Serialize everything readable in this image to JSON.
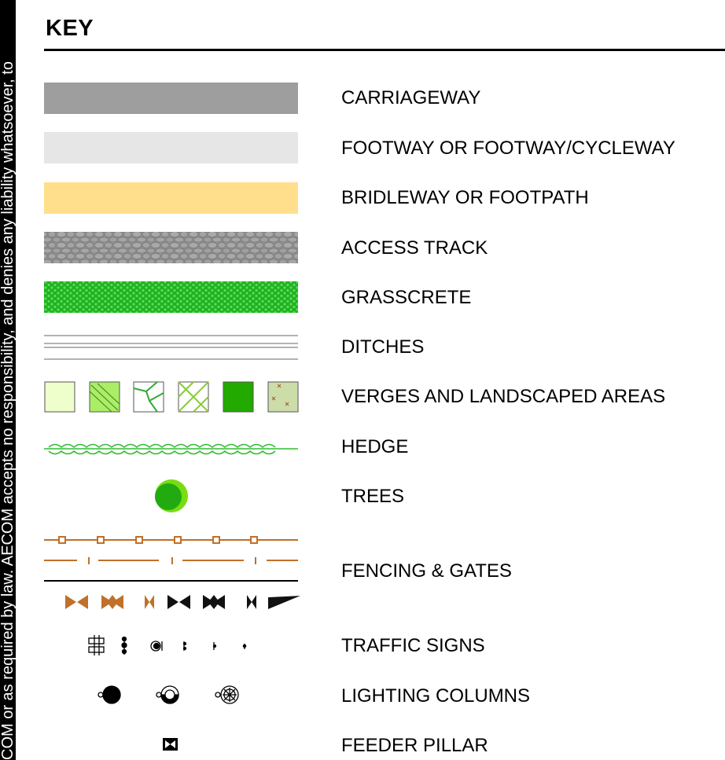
{
  "sidebar_text": "COM or as required by law. AECOM accepts no responsibility, and denies any liability whatsoever, to",
  "key_title": "KEY",
  "legend": {
    "carriageway": "CARRIAGEWAY",
    "footway": "FOOTWAY OR FOOTWAY/CYCLEWAY",
    "bridleway": "BRIDLEWAY OR FOOTPATH",
    "access_track": "ACCESS TRACK",
    "grasscrete": "GRASSCRETE",
    "ditches": "DITCHES",
    "verges": "VERGES AND LANDSCAPED AREAS",
    "hedge": "HEDGE",
    "trees": "TREES",
    "fencing": "FENCING & GATES",
    "traffic_signs": "TRAFFIC SIGNS",
    "lighting": "LIGHTING COLUMNS",
    "feeder_pillar": "FEEDER PILLAR"
  },
  "colors": {
    "carriageway": "#9e9e9e",
    "footway": "#e6e6e6",
    "bridleway": "#ffdf8c",
    "grasscrete": "#33cc33",
    "fence": "#c0702a",
    "tree": "#33bb22"
  }
}
